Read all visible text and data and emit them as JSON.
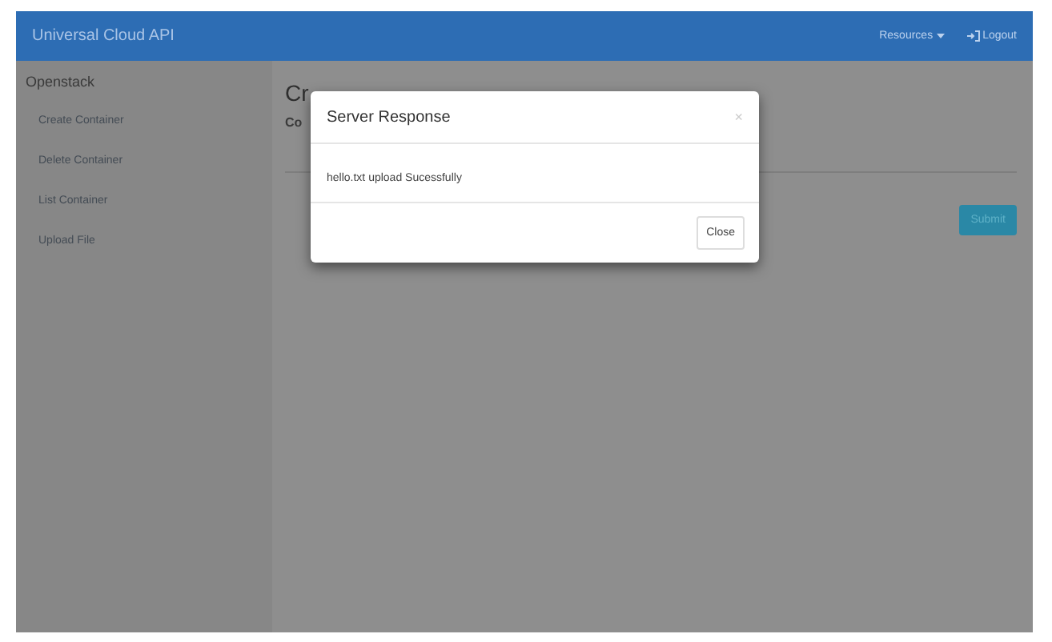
{
  "navbar": {
    "brand": "Universal Cloud API",
    "links": [
      {
        "kind": "dropdown",
        "label": "Resources"
      },
      {
        "kind": "logout",
        "label": "Logout"
      }
    ]
  },
  "sidebar": {
    "title": "Openstack",
    "items": [
      {
        "label": "Create Container"
      },
      {
        "label": "Delete Container"
      },
      {
        "label": "List Container"
      },
      {
        "label": "Upload File"
      }
    ]
  },
  "main": {
    "heading": "Cr",
    "field_label": "Co",
    "submit": "Submit"
  },
  "modal": {
    "title": "Server Response",
    "close_glyph": "×",
    "message": "hello.txt upload Sucessfully",
    "button": "Close"
  }
}
